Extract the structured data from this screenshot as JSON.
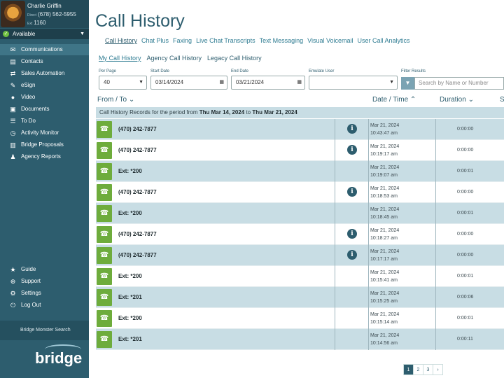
{
  "user": {
    "name": "Charlie Griffin",
    "direct_label": "Direct",
    "direct": "(678) 562-5955",
    "ext_label": "Ext",
    "ext": "1160"
  },
  "status": "Available",
  "nav": [
    {
      "label": "Communications",
      "icon": "envelope-icon"
    },
    {
      "label": "Contacts",
      "icon": "contact-card-icon"
    },
    {
      "label": "Sales Automation",
      "icon": "sales-icon"
    },
    {
      "label": "eSign",
      "icon": "esign-icon"
    },
    {
      "label": "Video",
      "icon": "video-icon"
    },
    {
      "label": "Documents",
      "icon": "documents-icon"
    },
    {
      "label": "To Do",
      "icon": "todo-list-icon"
    },
    {
      "label": "Activity Monitor",
      "icon": "activity-monitor-icon"
    },
    {
      "label": "Bridge Proposals",
      "icon": "proposals-icon"
    },
    {
      "label": "Agency Reports",
      "icon": "agency-reports-icon"
    }
  ],
  "bottom_nav": [
    {
      "label": "Guide",
      "icon": "star-icon"
    },
    {
      "label": "Support",
      "icon": "support-icon"
    },
    {
      "label": "Settings",
      "icon": "gear-icon"
    },
    {
      "label": "Log Out",
      "icon": "power-icon"
    }
  ],
  "search_label": "Bridge Monster Search",
  "logo_text": "bridge",
  "page_title": "Call History",
  "tabs": [
    "Call History",
    "Chat Plus",
    "Faxing",
    "Live Chat Transcripts",
    "Text Messaging",
    "Visual Voicemail",
    "User Call Analytics"
  ],
  "subtabs": [
    "My Call History",
    "Agency Call History",
    "Legacy Call History"
  ],
  "filters": {
    "per_page_label": "Per Page",
    "per_page": "40",
    "start_label": "Start Date",
    "start": "03/14/2024",
    "end_label": "End Date",
    "end": "03/21/2024",
    "emulate_label": "Emulate User",
    "emulate": "",
    "filter_label": "Filter Results",
    "filter_placeholder": "Search by Name or Number"
  },
  "columns": {
    "from_to": "From / To",
    "date_time": "Date / Time",
    "duration": "Duration",
    "extra": "S"
  },
  "period": {
    "prefix": "Call History Records for the period from",
    "start": "Thu Mar 14, 2024",
    "mid": "to",
    "end": "Thu Mar 21, 2024"
  },
  "rows": [
    {
      "who": "(470) 242-7877",
      "date": "Mar 21, 2024",
      "time": "10:43:47 am",
      "duration": "0:00:00",
      "info": true
    },
    {
      "who": "(470) 242-7877",
      "date": "Mar 21, 2024",
      "time": "10:19:17 am",
      "duration": "0:00:00",
      "info": true
    },
    {
      "who": "Ext: *200",
      "date": "Mar 21, 2024",
      "time": "10:19:07 am",
      "duration": "0:00:01",
      "info": false
    },
    {
      "who": "(470) 242-7877",
      "date": "Mar 21, 2024",
      "time": "10:18:53 am",
      "duration": "0:00:00",
      "info": true
    },
    {
      "who": "Ext: *200",
      "date": "Mar 21, 2024",
      "time": "10:18:45 am",
      "duration": "0:00:01",
      "info": false
    },
    {
      "who": "(470) 242-7877",
      "date": "Mar 21, 2024",
      "time": "10:18:27 am",
      "duration": "0:00:00",
      "info": true
    },
    {
      "who": "(470) 242-7877",
      "date": "Mar 21, 2024",
      "time": "10:17:17 am",
      "duration": "0:00:00",
      "info": true
    },
    {
      "who": "Ext: *200",
      "date": "Mar 21, 2024",
      "time": "10:15:41 am",
      "duration": "0:00:01",
      "info": false
    },
    {
      "who": "Ext: *201",
      "date": "Mar 21, 2024",
      "time": "10:15:25 am",
      "duration": "0:00:06",
      "info": false
    },
    {
      "who": "Ext: *200",
      "date": "Mar 21, 2024",
      "time": "10:15:14 am",
      "duration": "0:00:01",
      "info": false
    },
    {
      "who": "Ext: *201",
      "date": "Mar 21, 2024",
      "time": "10:14:56 am",
      "duration": "0:00:11",
      "info": false
    }
  ],
  "pagination": [
    "1",
    "2",
    "3",
    "›"
  ],
  "colors": {
    "sidebar": "#2d5d6e",
    "accent": "#2f7c92",
    "row_alt": "#c8dde4",
    "phone_green": "#6eac3c"
  }
}
